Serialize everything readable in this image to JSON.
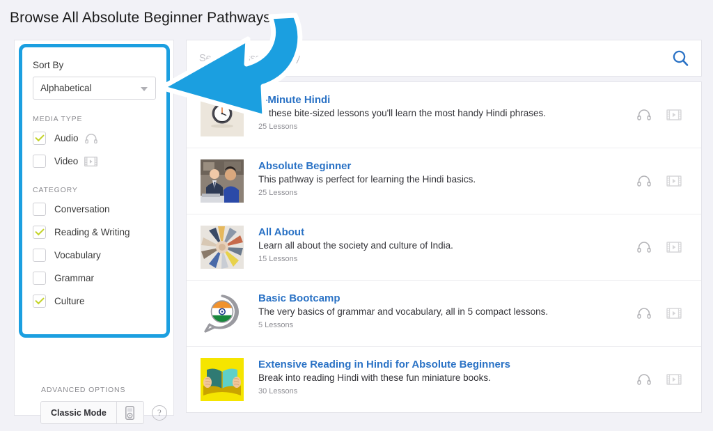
{
  "page": {
    "title": "Browse All Absolute Beginner Pathways",
    "background_color": "#f2f2f7",
    "accent_color": "#1b9fe0",
    "link_color": "#2a72c5",
    "check_color": "#c3d326"
  },
  "sidebar": {
    "sort": {
      "label": "Sort By",
      "value": "Alphabetical",
      "chevron_icon": "chevron-down-icon"
    },
    "media_type": {
      "heading": "Media Type",
      "options": [
        {
          "label": "Audio",
          "checked": true,
          "icon": "headphones-icon"
        },
        {
          "label": "Video",
          "checked": false,
          "icon": "film-strip-icon"
        }
      ]
    },
    "category": {
      "heading": "Category",
      "options": [
        {
          "label": "Conversation",
          "checked": false
        },
        {
          "label": "Reading & Writing",
          "checked": true
        },
        {
          "label": "Vocabulary",
          "checked": false
        },
        {
          "label": "Grammar",
          "checked": false
        },
        {
          "label": "Culture",
          "checked": true
        }
      ]
    },
    "advanced": {
      "heading": "Advanced Options",
      "classic_mode_label": "Classic Mode",
      "device_icon": "ipod-icon",
      "help_icon": "question-mark-icon",
      "help_label": "?"
    }
  },
  "search": {
    "placeholder": "Search Lesson Library",
    "value": "",
    "button_icon": "search-icon"
  },
  "lessons": [
    {
      "title": "3-Minute Hindi",
      "description": "In these bite-sized lessons you'll learn the most handy Hindi phrases.",
      "count": "25 Lessons",
      "thumbnail": "clock-thumbnail",
      "audio_icon": "headphones-icon",
      "video_icon": "film-strip-icon"
    },
    {
      "title": "Absolute Beginner",
      "description": "This pathway is perfect for learning the Hindi basics.",
      "count": "25 Lessons",
      "thumbnail": "business-people-photo-thumbnail",
      "audio_icon": "headphones-icon",
      "video_icon": "film-strip-icon"
    },
    {
      "title": "All About",
      "description": "Learn all about the society and culture of India.",
      "count": "15 Lessons",
      "thumbnail": "joined-hands-photo-thumbnail",
      "audio_icon": "headphones-icon",
      "video_icon": "film-strip-icon"
    },
    {
      "title": "Basic Bootcamp",
      "description": "The very basics of grammar and vocabulary, all in 5 compact lessons.",
      "count": "5 Lessons",
      "thumbnail": "speech-bubble-india-flag-thumbnail",
      "audio_icon": "headphones-icon",
      "video_icon": "film-strip-icon"
    },
    {
      "title": "Extensive Reading in Hindi for Absolute Beginners",
      "description": "Break into reading Hindi with these fun miniature books.",
      "count": "30 Lessons",
      "thumbnail": "open-book-thumbnail",
      "audio_icon": "headphones-icon",
      "video_icon": "film-strip-icon"
    }
  ],
  "annotation": {
    "arrow_icon": "curved-left-arrow-annotation",
    "arrow_color": "#1b9fe0",
    "points_to": "sort-by-filter-panel"
  }
}
